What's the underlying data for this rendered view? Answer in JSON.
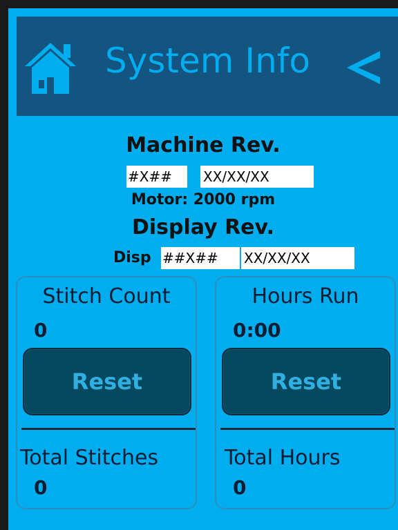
{
  "header": {
    "title": "System Info",
    "home_icon": "home-icon",
    "back_icon": "chevron-left-icon",
    "accent_color": "#00aeef",
    "header_color": "#145480"
  },
  "machine_rev": {
    "heading": "Machine Rev.",
    "code": "#X##",
    "date": "XX/XX/XX",
    "motor": "Motor: 2000 rpm"
  },
  "display_rev": {
    "heading": "Display Rev.",
    "prefix": "Disp",
    "code": "##X##",
    "date": "XX/XX/XX"
  },
  "stitch": {
    "label": "Stitch Count",
    "value": "0",
    "reset_label": "Reset",
    "total_label": "Total Stitches",
    "total_value": "0"
  },
  "hours": {
    "label": "Hours Run",
    "value": "0:00",
    "reset_label": "Reset",
    "total_label": "Total Hours",
    "total_value": "0"
  }
}
